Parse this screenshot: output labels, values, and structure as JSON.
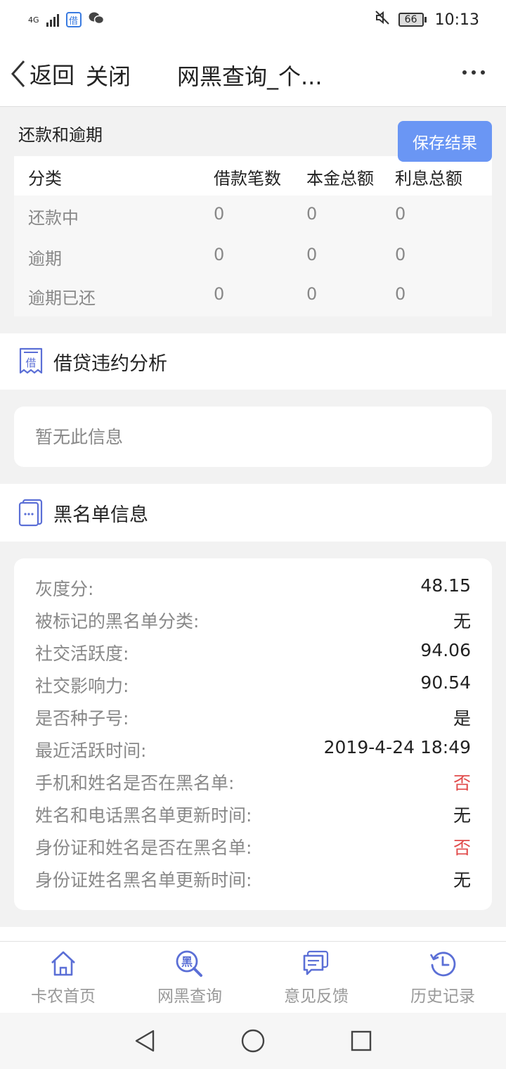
{
  "status_bar": {
    "network": "4G",
    "app_icon_text": "借",
    "battery": "66",
    "time": "10:13"
  },
  "nav": {
    "back_label": "返回",
    "close_label": "关闭",
    "title": "网黑查询_个..."
  },
  "repayment": {
    "section_title": "还款和逾期",
    "save_button": "保存结果",
    "columns": [
      "分类",
      "借款笔数",
      "本金总额",
      "利息总额"
    ],
    "rows": [
      [
        "还款中",
        "0",
        "0",
        "0"
      ],
      [
        "逾期",
        "0",
        "0",
        "0"
      ],
      [
        "逾期已还",
        "0",
        "0",
        "0"
      ]
    ]
  },
  "default_analysis": {
    "title": "借贷违约分析",
    "icon_text": "借",
    "empty_text": "暂无此信息"
  },
  "blacklist": {
    "title": "黑名单信息",
    "items": [
      {
        "label": "灰度分:",
        "value": "48.15"
      },
      {
        "label": "被标记的黑名单分类:",
        "value": "无"
      },
      {
        "label": "社交活跃度:",
        "value": "94.06"
      },
      {
        "label": "社交影响力:",
        "value": "90.54"
      },
      {
        "label": "是否种子号:",
        "value": "是"
      },
      {
        "label": "最近活跃时间:",
        "value": "2019-4-24 18:49"
      },
      {
        "label": "手机和姓名是否在黑名单:",
        "value": "否"
      },
      {
        "label": "姓名和电话黑名单更新时间:",
        "value": "无"
      },
      {
        "label": "身份证和姓名是否在黑名单:",
        "value": "否"
      },
      {
        "label": "身份证姓名黑名单更新时间:",
        "value": "无"
      }
    ]
  },
  "tabbar": {
    "tabs": [
      {
        "label": "卡农首页",
        "icon": "home-icon"
      },
      {
        "label": "网黑查询",
        "icon": "search-black-icon",
        "icon_text": "黑"
      },
      {
        "label": "意见反馈",
        "icon": "feedback-icon"
      },
      {
        "label": "历史记录",
        "icon": "history-icon"
      }
    ]
  },
  "colors": {
    "accent": "#6a96f4",
    "icon_blue": "#5b6fd6",
    "negative_red": "#e14b4b"
  }
}
